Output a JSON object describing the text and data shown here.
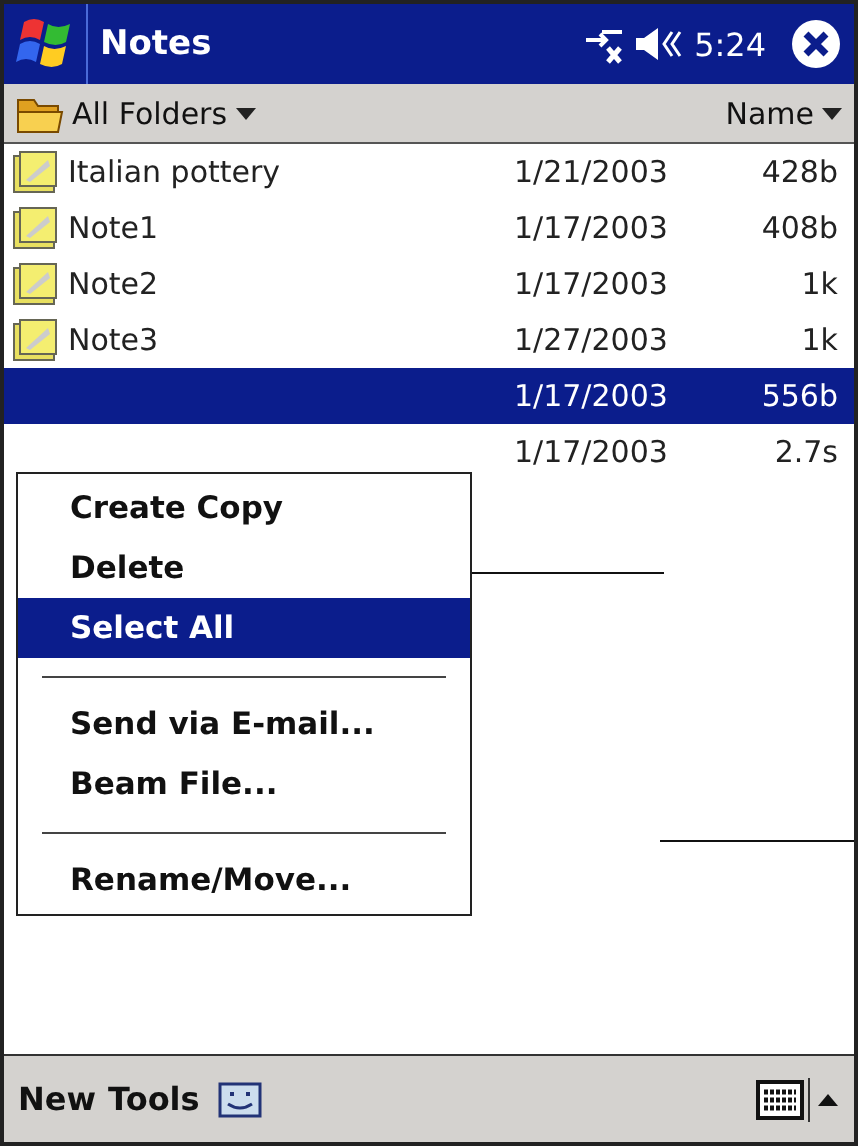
{
  "title_bar": {
    "title": "Notes",
    "time": "5:24"
  },
  "folder_bar": {
    "folder": "All Folders",
    "sort": "Name"
  },
  "notes": [
    {
      "name": "Italian pottery",
      "date": "1/21/2003",
      "size": "428b",
      "selected": false
    },
    {
      "name": "Note1",
      "date": "1/17/2003",
      "size": "408b",
      "selected": false
    },
    {
      "name": "Note2",
      "date": "1/17/2003",
      "size": "1k",
      "selected": false
    },
    {
      "name": "Note3",
      "date": "1/27/2003",
      "size": "1k",
      "selected": false
    },
    {
      "date": "1/17/2003",
      "size": "556b",
      "selected": true
    },
    {
      "date": "1/17/2003",
      "size": "2.7s",
      "selected": false
    }
  ],
  "context_menu": [
    {
      "kind": "item",
      "label": "Create Copy",
      "selected": false
    },
    {
      "kind": "item",
      "label": "Delete",
      "selected": false
    },
    {
      "kind": "item",
      "label": "Select All",
      "selected": true
    },
    {
      "kind": "separator"
    },
    {
      "kind": "item",
      "label": "Send via E-mail...",
      "selected": false
    },
    {
      "kind": "item",
      "label": "Beam File...",
      "selected": false
    },
    {
      "kind": "separator"
    },
    {
      "kind": "item",
      "label": "Rename/Move...",
      "selected": false
    }
  ],
  "command_bar": {
    "menus": [
      "New",
      "Tools"
    ]
  }
}
